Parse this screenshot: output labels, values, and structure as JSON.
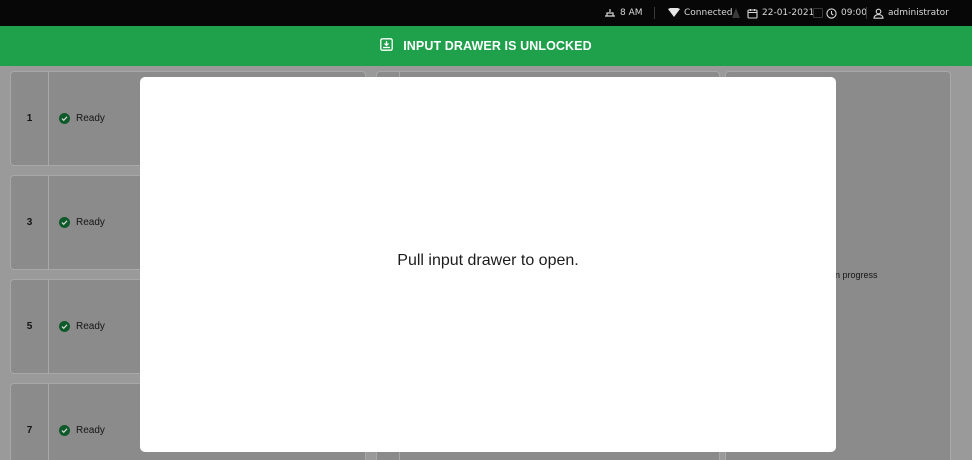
{
  "status_bar": {
    "shift": "8 AM",
    "connection": "Connected",
    "date": "22-01-2021",
    "time": "09:00",
    "user": "administrator"
  },
  "banner": {
    "text": "INPUT DRAWER IS UNLOCKED",
    "color": "#1fa04b"
  },
  "slots": [
    {
      "number": "1",
      "status": "Ready"
    },
    {
      "number": "3",
      "status": "Ready"
    },
    {
      "number": "5",
      "status": "Ready"
    },
    {
      "number": "7",
      "status": "Ready"
    }
  ],
  "right_panel": {
    "partial_text": "n progress"
  },
  "modal": {
    "message": "Pull input drawer to open."
  }
}
